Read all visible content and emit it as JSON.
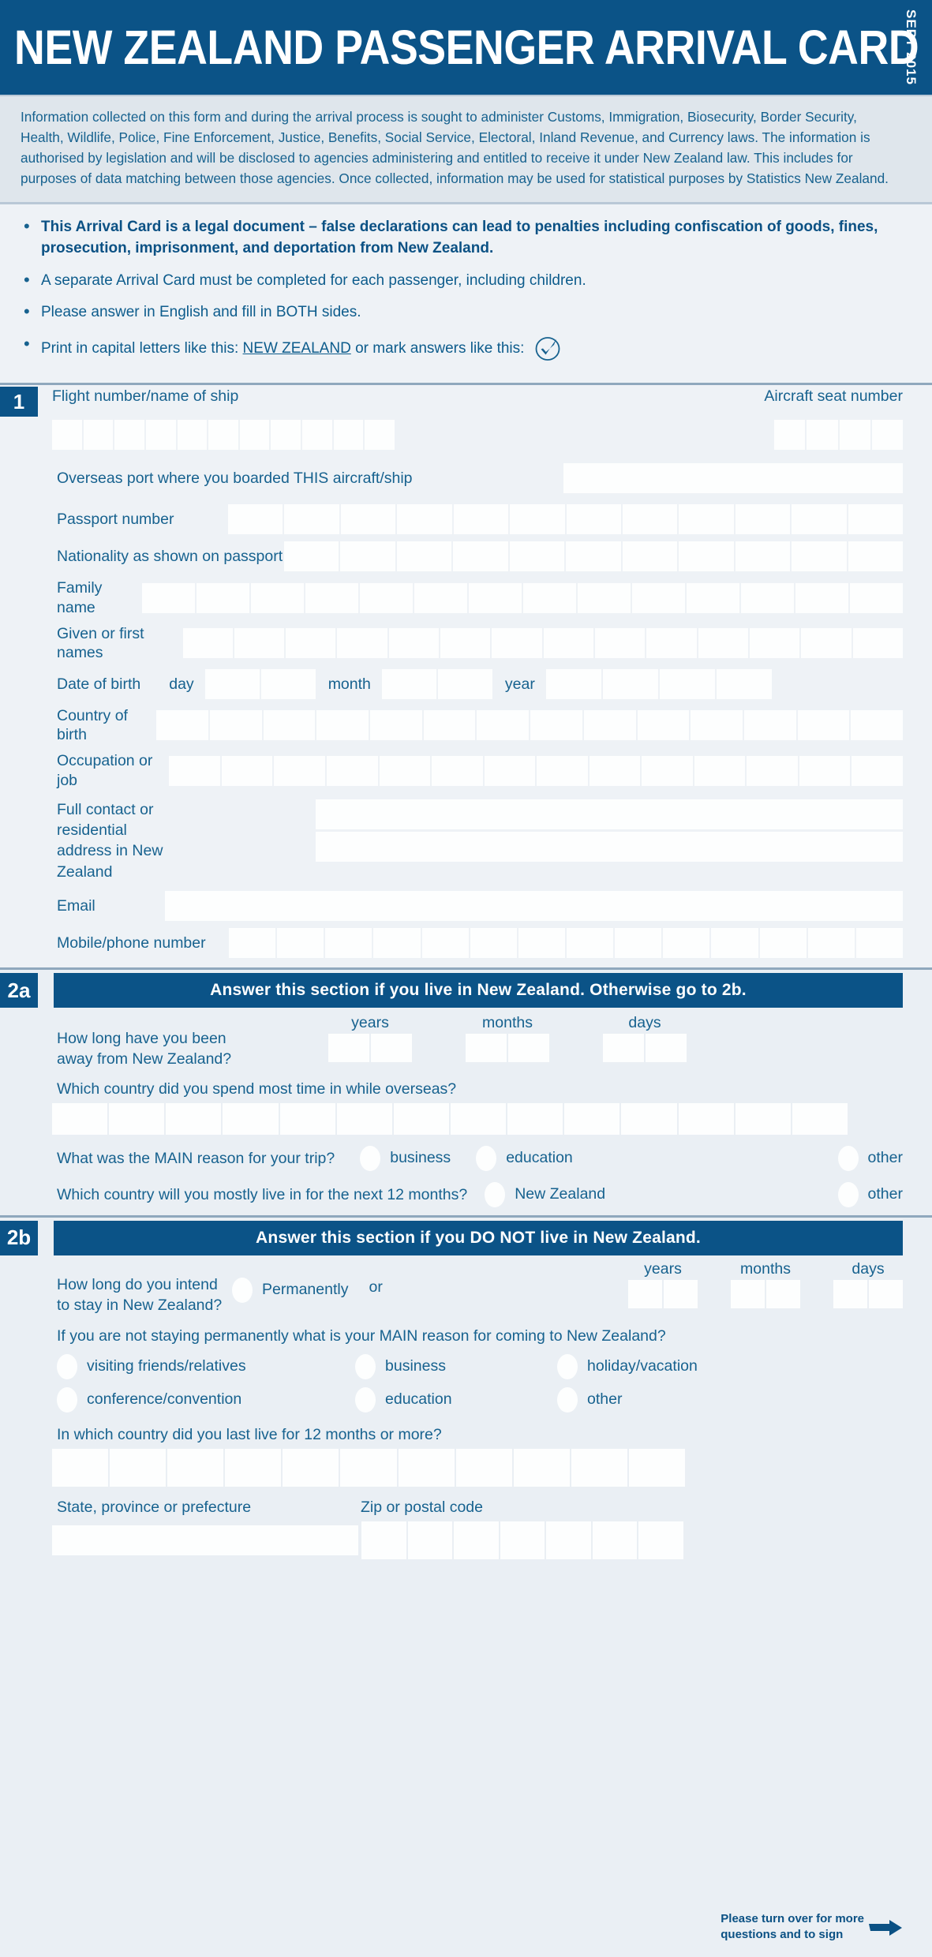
{
  "header": {
    "title": "NEW ZEALAND PASSENGER ARRIVAL CARD",
    "date": "SEPT 2015",
    "bg_color": "#0b5387"
  },
  "info": {
    "paragraph": "Information collected on this form and during the arrival process is sought to administer Customs, Immigration, Biosecurity, Border Security, Health, Wildlife, Police, Fine Enforcement, Justice, Benefits, Social Service, Electoral, Inland Revenue, and Currency laws. The information is authorised by legislation and will be disclosed to agencies administering and entitled to receive it under New Zealand law. This includes for purposes of data matching between those agencies. Once collected, information may be used for statistical purposes by Statistics New Zealand."
  },
  "bullets": [
    {
      "text": "This Arrival Card is a legal document – false declarations can lead to penalties including confiscation of goods, fines, prosecution, imprisonment, and deportation from New Zealand.",
      "bold": true
    },
    {
      "text": "A separate Arrival Card must be completed for each passenger, including children.",
      "bold": false
    },
    {
      "text": "Please answer in English and fill in BOTH sides.",
      "bold": false
    },
    {
      "text_before": "Print in capital letters like this:",
      "text_caps": "NEW ZEALAND",
      "text_after": "or mark answers like this:",
      "icon": "tick-in-circle-icon",
      "bold": false
    }
  ],
  "section1": {
    "number": "1",
    "flight_label": "Flight number/name of ship",
    "flight_boxes": 11,
    "seat_label": "Aircraft seat number",
    "seat_boxes": 4,
    "port_label": "Overseas port where you boarded THIS aircraft/ship",
    "passport_label": "Passport number",
    "passport_boxes": 12,
    "nationality_label": "Nationality as shown on passport",
    "nationality_boxes": 11,
    "family_name_label": "Family name",
    "family_name_boxes": 14,
    "given_names_label": "Given or first names",
    "given_names_boxes": 14,
    "dob_label": "Date of birth",
    "dob_day_label": "day",
    "dob_day_boxes": 2,
    "dob_month_label": "month",
    "dob_month_boxes": 2,
    "dob_year_label": "year",
    "dob_year_boxes": 4,
    "country_birth_label": "Country of birth",
    "country_birth_boxes": 14,
    "occupation_label": "Occupation or job",
    "occupation_boxes": 14,
    "address_label_line1": "Full contact or residential",
    "address_label_line2": "address in New Zealand",
    "email_label": "Email",
    "mobile_label": "Mobile/phone number",
    "mobile_boxes": 14
  },
  "section2a": {
    "number": "2a",
    "title": "Answer this section if you live in New Zealand. Otherwise go to 2b.",
    "away_label_line1": "How long have you been",
    "away_label_line2": "away from New Zealand?",
    "years_label": "years",
    "months_label": "months",
    "days_label": "days",
    "years_boxes": 2,
    "months_boxes": 2,
    "days_boxes": 2,
    "most_time_question": "Which country did you spend most time in while overseas?",
    "most_time_boxes": 14,
    "main_reason_question": "What was the MAIN reason for your trip?",
    "main_reason_options": [
      "business",
      "education",
      "other"
    ],
    "next12_question": "Which country will you mostly live in for the next 12 months?",
    "next12_options": [
      "New Zealand",
      "other"
    ]
  },
  "section2b": {
    "number": "2b",
    "title": "Answer this section if you DO NOT live in New Zealand.",
    "stay_label_line1": "How long do you intend",
    "stay_label_line2": "to stay in New Zealand?",
    "permanently_label": "Permanently",
    "or_label": "or",
    "years_label": "years",
    "months_label": "months",
    "days_label": "days",
    "years_boxes": 2,
    "months_boxes": 2,
    "days_boxes": 2,
    "reason_question": "If you are not staying permanently what is your MAIN reason for coming to New Zealand?",
    "reason_options_row1": [
      "visiting friends/relatives",
      "business",
      "holiday/vacation"
    ],
    "reason_options_row2": [
      "conference/convention",
      "education",
      "other"
    ],
    "last_live_question": "In which country did you last live for 12 months or more?",
    "last_live_boxes": 11,
    "state_label": "State, province or prefecture",
    "zip_label": "Zip or postal code",
    "zip_boxes": 7
  },
  "footer": {
    "line1": "Please turn over for more",
    "line2": "questions and to sign",
    "icon": "right-arrow-icon"
  },
  "colors": {
    "brand_blue": "#0b5387",
    "label_blue": "#17628f",
    "page_bg": "#eef2f6",
    "info_bg": "#dfe6ec",
    "box_white": "#fdfefe"
  }
}
